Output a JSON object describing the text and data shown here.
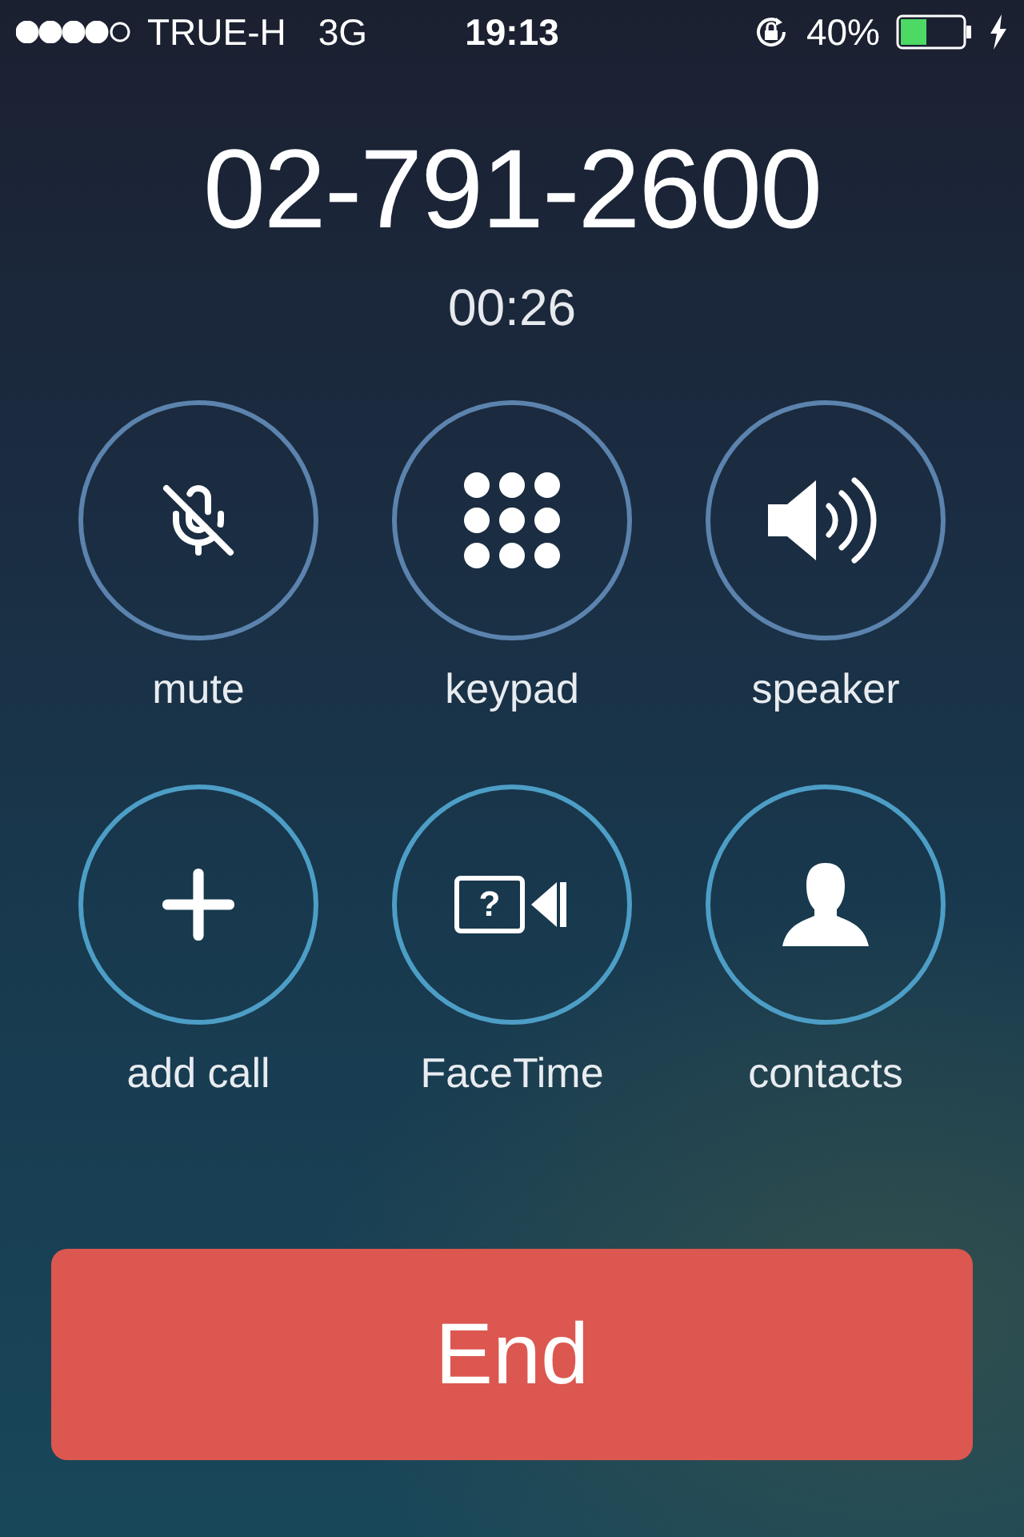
{
  "status_bar": {
    "carrier": "TRUE-H",
    "network": "3G",
    "time": "19:13",
    "battery_percent": "40%"
  },
  "call": {
    "number": "02-791-2600",
    "duration": "00:26"
  },
  "controls": [
    {
      "kind": "mute",
      "label": "mute"
    },
    {
      "kind": "keypad",
      "label": "keypad"
    },
    {
      "kind": "speaker",
      "label": "speaker"
    },
    {
      "kind": "add",
      "label": "add call"
    },
    {
      "kind": "facetime",
      "label": "FaceTime",
      "icon_text": "?"
    },
    {
      "kind": "contacts",
      "label": "contacts"
    }
  ],
  "end_button": {
    "label": "End"
  }
}
